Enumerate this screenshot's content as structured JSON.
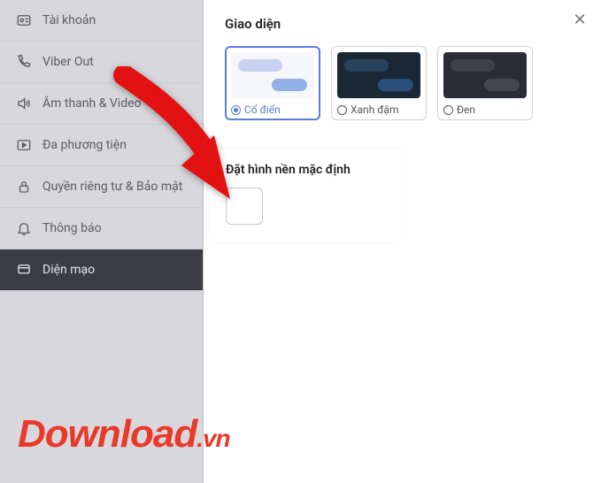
{
  "sidebar": {
    "items": [
      {
        "label": "Tài khoản"
      },
      {
        "label": "Viber Out"
      },
      {
        "label": "Âm thanh & Video"
      },
      {
        "label": "Đa phương tiện"
      },
      {
        "label": "Quyền riêng tư & Bảo mật"
      },
      {
        "label": "Thông báo"
      },
      {
        "label": "Diện mạo"
      }
    ]
  },
  "main": {
    "section_title": "Giao diện",
    "themes": [
      {
        "label": "Cổ điển",
        "selected": true,
        "variant": "light"
      },
      {
        "label": "Xanh đậm",
        "selected": false,
        "variant": "navy"
      },
      {
        "label": "Đen",
        "selected": false,
        "variant": "dark"
      }
    ]
  },
  "highlight": {
    "title": "Đặt hình nền mặc định"
  },
  "watermark": {
    "main": "Download",
    "domain": ".vn"
  },
  "colors": {
    "accent": "#5b7dd6",
    "arrow": "#e31111"
  }
}
